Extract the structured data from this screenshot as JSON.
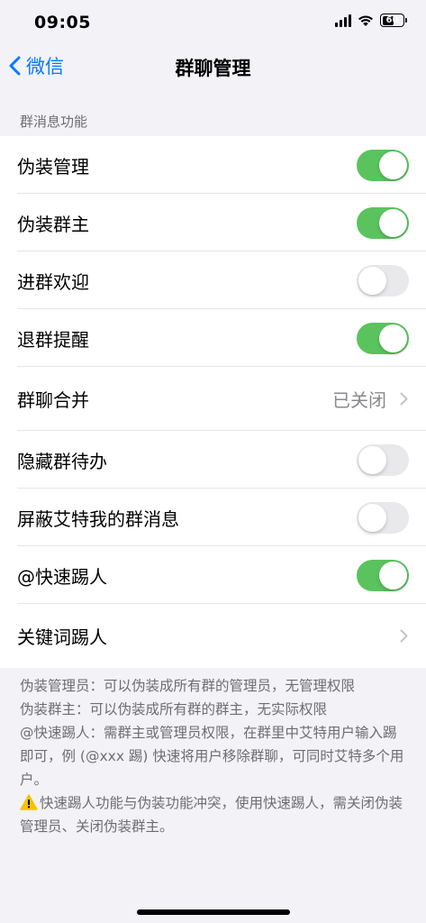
{
  "status_bar": {
    "time": "09:05",
    "battery": "60",
    "battery_level": 0.6
  },
  "nav": {
    "back_label": "微信",
    "title": "群聊管理"
  },
  "section": {
    "header": "群消息功能"
  },
  "rows": [
    {
      "label": "伪装管理",
      "type": "toggle",
      "on": true
    },
    {
      "label": "伪装群主",
      "type": "toggle",
      "on": true
    },
    {
      "label": "进群欢迎",
      "type": "toggle",
      "on": false
    },
    {
      "label": "退群提醒",
      "type": "toggle",
      "on": true
    },
    {
      "label": "群聊合并",
      "type": "link",
      "value": "已关闭"
    },
    {
      "label": "隐藏群待办",
      "type": "toggle",
      "on": false
    },
    {
      "label": "屏蔽艾特我的群消息",
      "type": "toggle",
      "on": false
    },
    {
      "label": "@快速踢人",
      "type": "toggle",
      "on": true
    },
    {
      "label": "关键词踢人",
      "type": "link",
      "value": ""
    }
  ],
  "footer": {
    "line1": "伪装管理员：可以伪装成所有群的管理员，无管理权限",
    "line2": "伪装群主：可以伪装成所有群的群主，无实际权限",
    "line3": "@快速踢人：需群主或管理员权限，在群里中艾特用户输入踢即可，例 (@xxx 踢) 快速将用户移除群聊，可同时艾特多个用户。",
    "line4": "快速踢人功能与伪装功能冲突，使用快速踢人，需关闭伪装管理员、关闭伪装群主。"
  },
  "colors": {
    "accent": "#007aff",
    "toggle_on": "#5ac35e",
    "toggle_off": "#e9e9eb",
    "warning": "#f5c400"
  }
}
